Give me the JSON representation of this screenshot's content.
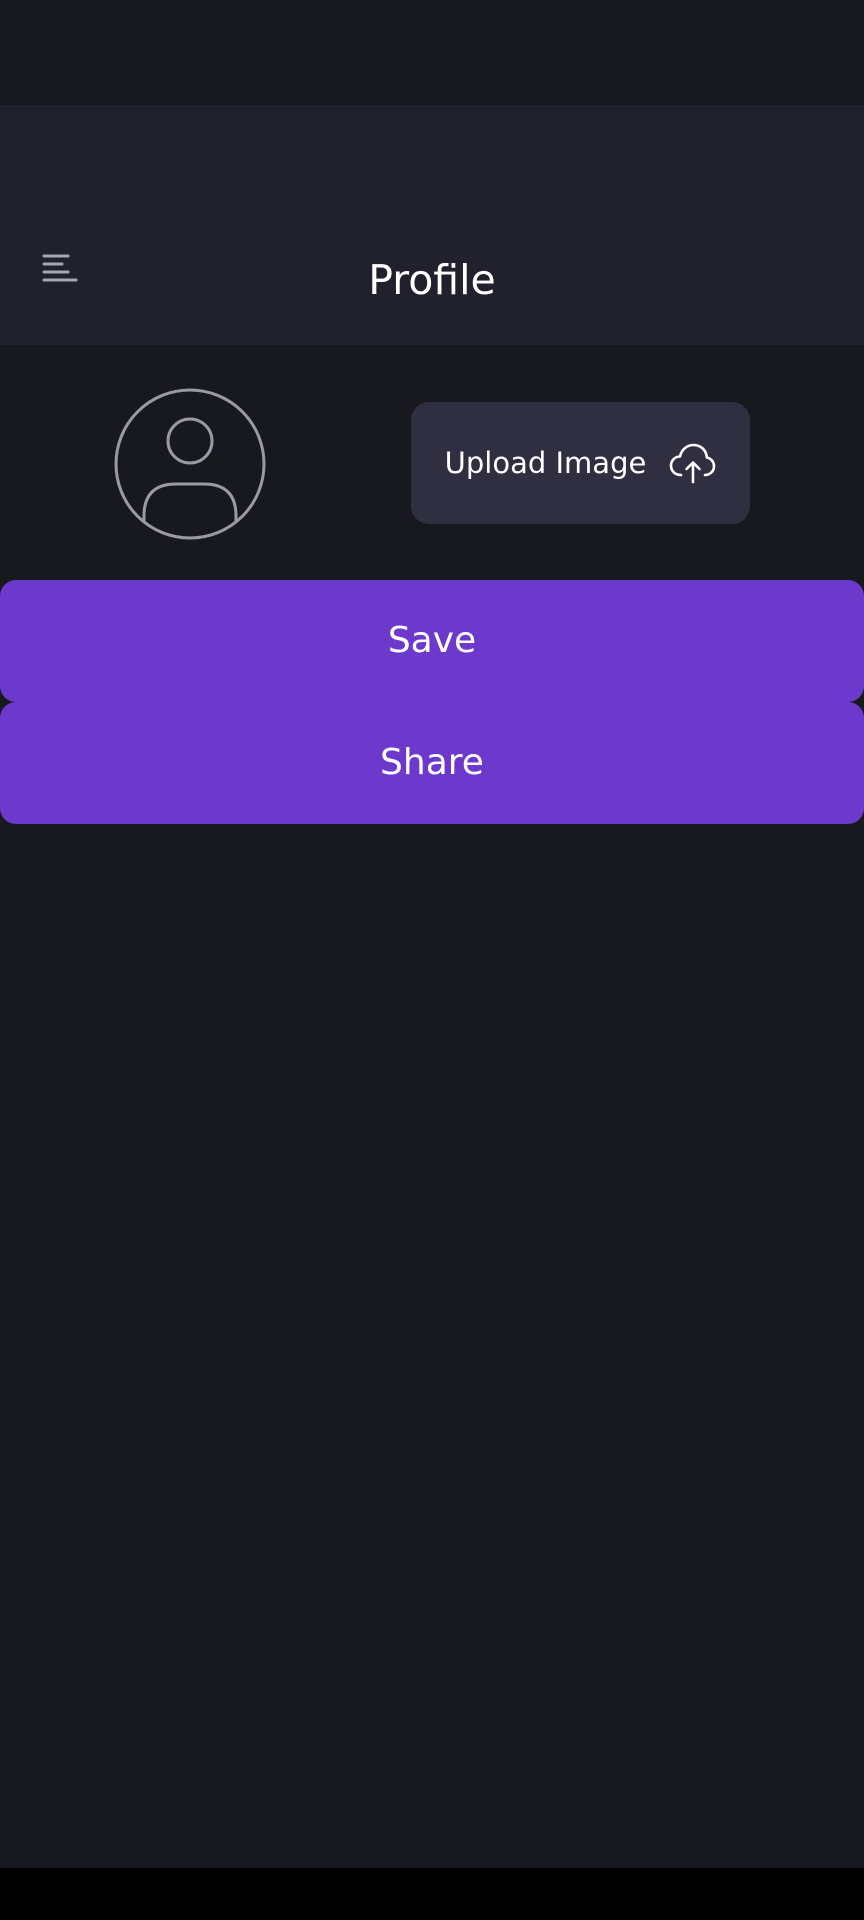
{
  "app_bar": {
    "title": "Profile",
    "menu_icon": "menu-icon"
  },
  "profile": {
    "avatar_icon": "user-icon",
    "upload_label": "Upload Image",
    "upload_icon": "cloud-upload-icon"
  },
  "actions": {
    "save_label": "Save",
    "share_label": "Share"
  },
  "colors": {
    "background": "#18191e",
    "app_bar": "#21212d",
    "upload_button": "#302f41",
    "accent": "#6d38cc",
    "text": "#ffffff",
    "icon_stroke": "#9a9aa5"
  }
}
